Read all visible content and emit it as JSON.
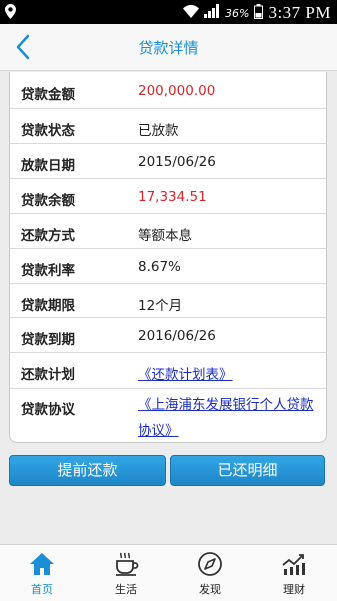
{
  "status_bar": {
    "battery": "36%",
    "time": "3:37 PM"
  },
  "header": {
    "title": "贷款详情"
  },
  "loan": {
    "rows": [
      {
        "label": "贷款金额",
        "value": "200,000.00"
      },
      {
        "label": "贷款状态",
        "value": "已放款"
      },
      {
        "label": "放款日期",
        "value": "2015/06/26"
      },
      {
        "label": "贷款余额",
        "value": "17,334.51"
      },
      {
        "label": "还款方式",
        "value": "等额本息"
      },
      {
        "label": "贷款利率",
        "value": "8.67%"
      },
      {
        "label": "贷款期限",
        "value": "12个月"
      },
      {
        "label": "贷款到期",
        "value": "2016/06/26"
      },
      {
        "label": "还款计划",
        "value": "《还款计划表》"
      },
      {
        "label": "贷款协议",
        "value_line1": "《上海浦东发展银行个人贷款",
        "value_line2": "协议》"
      }
    ]
  },
  "actions": {
    "prepay": "提前还款",
    "repaid_detail": "已还明细"
  },
  "nav": [
    {
      "label": "首页"
    },
    {
      "label": "生活"
    },
    {
      "label": "发现"
    },
    {
      "label": "理财"
    }
  ],
  "colors": {
    "accent": "#1a8fd6",
    "amount_red": "#d9262b",
    "link_blue": "#1b2cc4"
  }
}
